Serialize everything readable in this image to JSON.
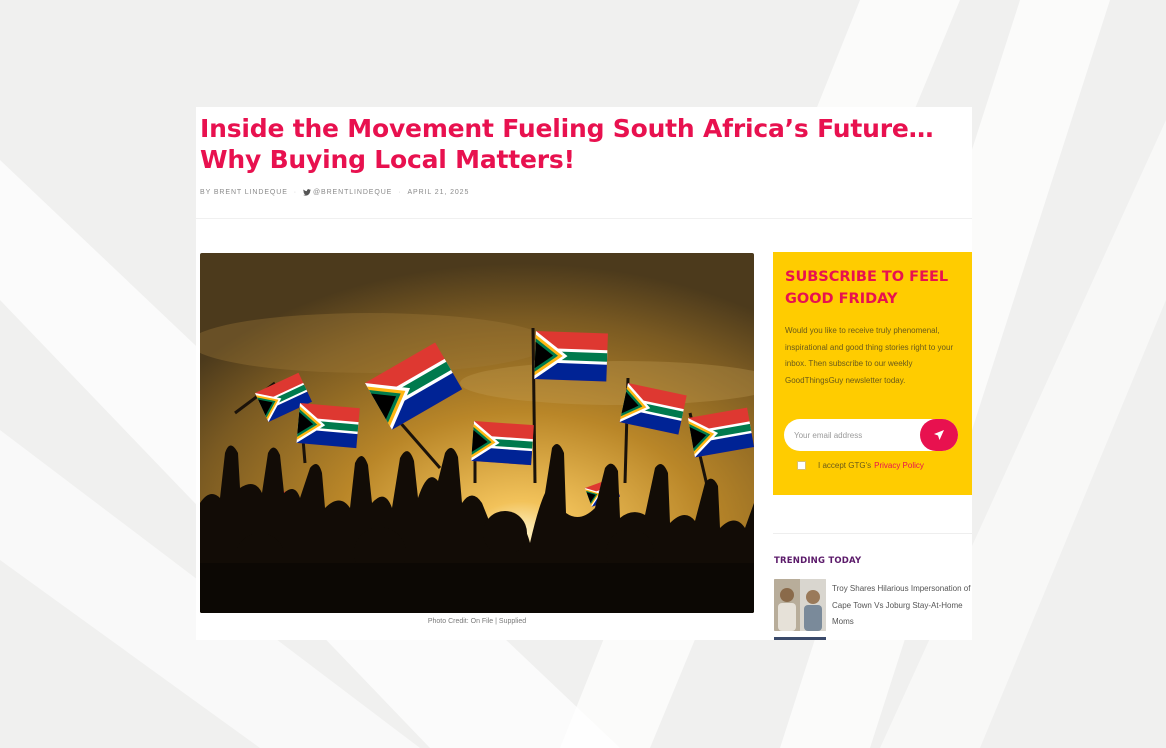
{
  "article": {
    "title": "Inside the Movement Fueling South Africa’s Future… Why Buying Local Matters!",
    "author": "BY BRENT LINDEQUE",
    "twitter_handle": "@BRENTLINDEQUE",
    "date": "APRIL 21, 2025",
    "image_caption": "Photo Credit: On File | Supplied"
  },
  "subscribe": {
    "title": "SUBSCRIBE TO FEEL GOOD FRIDAY",
    "text": "Would you like to receive truly phenomenal, inspirational and good thing stories right to your inbox. Then subscribe to our weekly GoodThingsGuy newsletter today.",
    "email_placeholder": "Your email address",
    "email_value": "",
    "consent_prefix": "I accept GTG's",
    "consent_link": "Privacy Policy",
    "send_icon": "send-icon"
  },
  "trending": {
    "title": "TRENDING TODAY",
    "items": [
      {
        "title": "Troy Shares Hilarious Impersonation of Cape Town Vs Joburg Stay-At-Home Moms"
      }
    ]
  },
  "colors": {
    "accent": "#e8114f",
    "subscribe_bg": "#ffcc00",
    "trending_title": "#5b1a6a",
    "page_bg": "#f0f0ef"
  }
}
